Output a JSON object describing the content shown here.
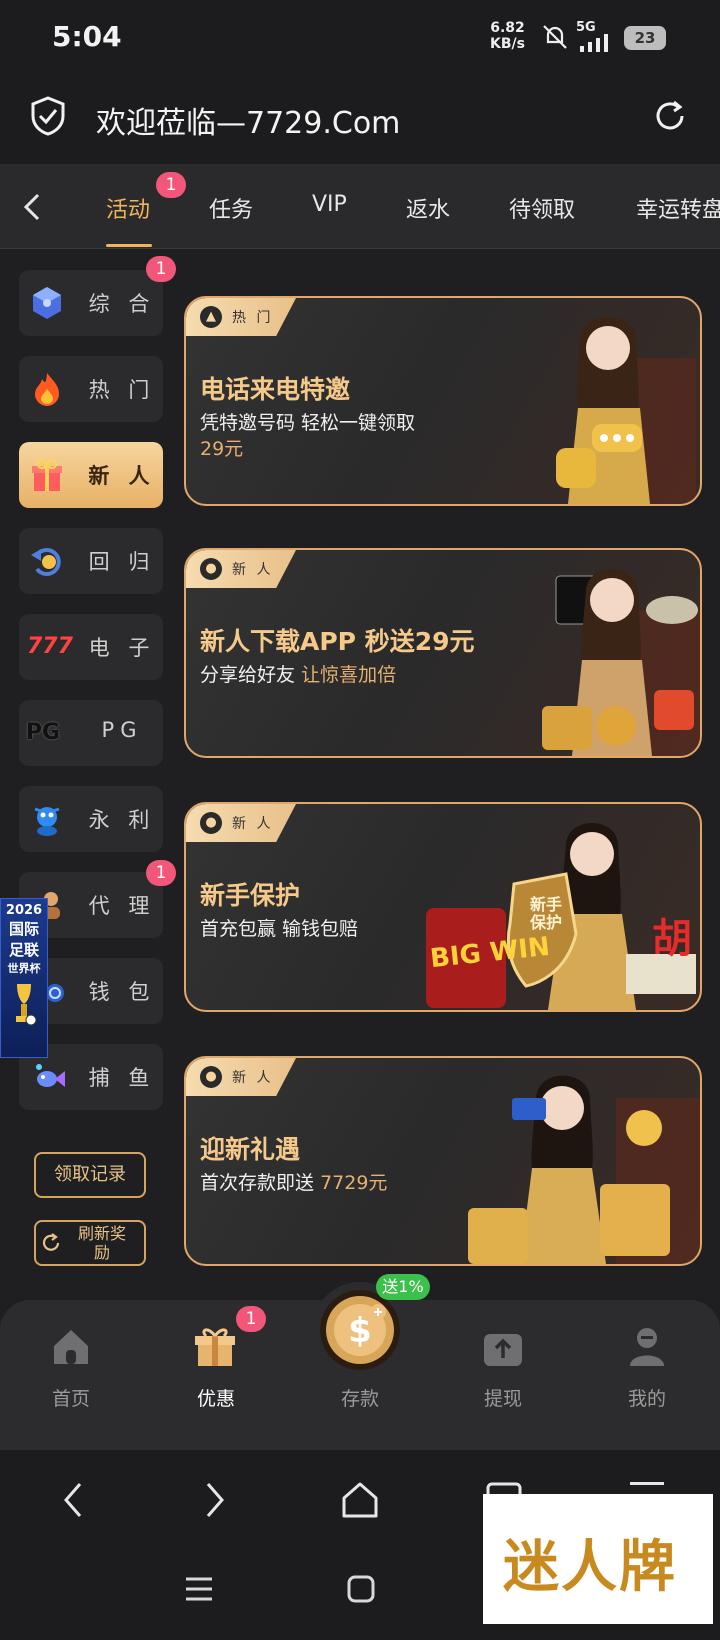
{
  "status": {
    "time": "5:04",
    "speed_value": "6.82",
    "speed_unit": "KB/s",
    "network": "5G",
    "battery": "23"
  },
  "browser": {
    "title": "欢迎莅临—7729.Com"
  },
  "tabs": [
    {
      "label": "活动",
      "badge": "1"
    },
    {
      "label": "任务"
    },
    {
      "label": "VIP"
    },
    {
      "label": "返水"
    },
    {
      "label": "待领取"
    },
    {
      "label": "幸运转盘"
    }
  ],
  "sidebar": {
    "items": [
      {
        "label": "综 合",
        "badge": "1",
        "icon": "cube-icon"
      },
      {
        "label": "热 门",
        "icon": "flame-icon"
      },
      {
        "label": "新 人",
        "icon": "gift-icon"
      },
      {
        "label": "回 归",
        "icon": "return-coin-icon"
      },
      {
        "label": "电 子",
        "icon": "slot-777-icon"
      },
      {
        "label": "PG",
        "icon": "pg-logo-icon"
      },
      {
        "label": "永 利",
        "icon": "mascot-icon"
      },
      {
        "label": "代 理",
        "badge": "1",
        "icon": "agent-icon"
      },
      {
        "label": "钱 包",
        "icon": "wallet-icon"
      },
      {
        "label": "捕 鱼",
        "icon": "fish-icon"
      }
    ],
    "record_button": "领取记录",
    "refresh_button": "刷新奖励",
    "float_banner": {
      "line1": "2026",
      "line2": "国际",
      "line3": "足联",
      "line4": "世界杯"
    }
  },
  "cards": [
    {
      "tag": "热 门",
      "title": "电话来电特邀",
      "sub": "凭特邀号码 轻松一键领取",
      "amount": "29元"
    },
    {
      "tag": "新 人",
      "title": "新人下载APP 秒送29元",
      "sub": "分享给好友",
      "sub_highlight": "让惊喜加倍"
    },
    {
      "tag": "新 人",
      "title": "新手保护",
      "sub": "首充包赢 输钱包赔",
      "art": {
        "bigwin": "BIG WIN",
        "shield": "新手保护",
        "tile": "胡"
      }
    },
    {
      "tag": "新 人",
      "title": "迎新礼遇",
      "sub": "首次存款即送",
      "sub_highlight": "7729元"
    }
  ],
  "bottom_nav": {
    "items": [
      {
        "label": "首页",
        "icon": "home-icon"
      },
      {
        "label": "优惠",
        "icon": "gift-box-icon",
        "badge": "1"
      },
      {
        "label": "存款",
        "icon": "deposit-coin-icon",
        "bubble": "送1%"
      },
      {
        "label": "提现",
        "icon": "withdraw-icon"
      },
      {
        "label": "我的",
        "icon": "profile-icon"
      }
    ]
  },
  "watermark": "迷人牌",
  "colors": {
    "accent": "#f0b45b",
    "badge": "#f2577a",
    "card_border": "#e0a76a",
    "background": "#1f1f21"
  }
}
